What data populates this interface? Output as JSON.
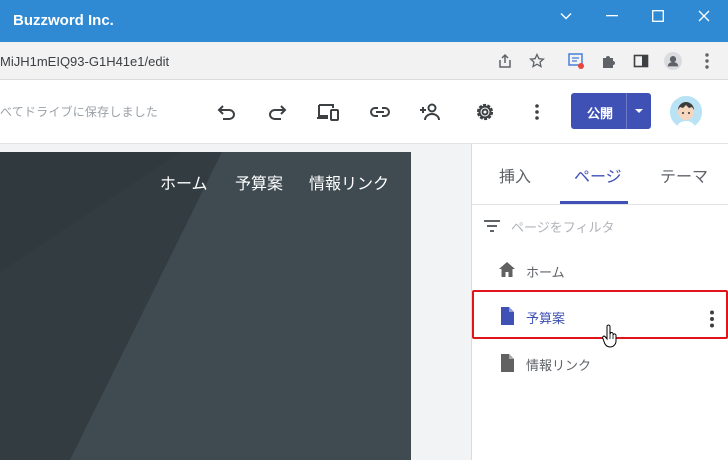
{
  "window": {
    "title": "Buzzword Inc.",
    "controls": [
      "chevron-down",
      "minimize",
      "maximize",
      "close"
    ]
  },
  "address_bar": {
    "url": "MiJH1mEIQ93-G1H41e1/edit",
    "icons": [
      "share-icon",
      "star-icon",
      "reader-icon",
      "puzzle-icon",
      "sidepanel-icon",
      "profile-icon",
      "kebab-icon"
    ]
  },
  "toolbar": {
    "save_status": "べてドライブに保存しました",
    "publish_label": "公開",
    "icons": [
      "undo-icon",
      "redo-icon",
      "preview-devices-icon",
      "link-icon",
      "add-person-icon",
      "settings-icon",
      "more-vert-icon"
    ],
    "accent_color": "#3f51b5"
  },
  "site": {
    "nav": [
      "ホーム",
      "予算案",
      "情報リンク"
    ]
  },
  "panel": {
    "tabs": [
      {
        "label": "挿入",
        "active": false
      },
      {
        "label": "ページ",
        "active": true
      },
      {
        "label": "テーマ",
        "active": false
      }
    ],
    "filter_placeholder": "ページをフィルタ",
    "pages": [
      {
        "label": "ホーム",
        "icon": "home-icon",
        "selected": false
      },
      {
        "label": "予算案",
        "icon": "page-icon",
        "selected": true
      },
      {
        "label": "情報リンク",
        "icon": "page-icon",
        "selected": false
      }
    ]
  },
  "colors": {
    "titlebar": "#2f8ad3",
    "highlight": "#e0141b"
  }
}
